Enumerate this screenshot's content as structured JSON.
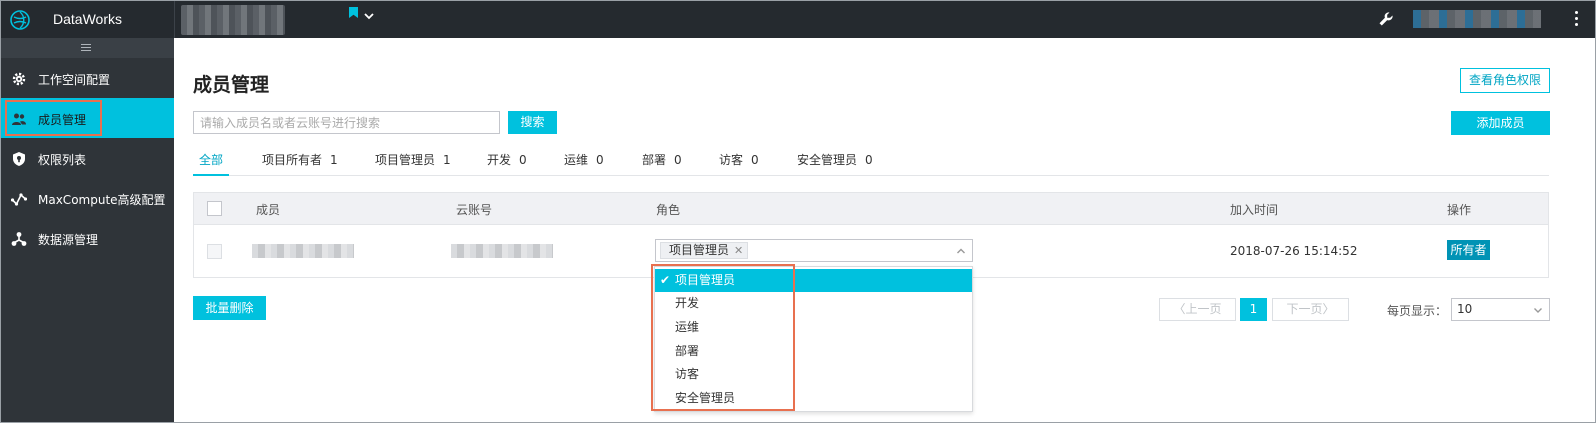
{
  "topbar": {
    "brand_name": "DataWorks"
  },
  "sidebar": {
    "items": [
      {
        "label": "工作空间配置",
        "icon": "gear-icon"
      },
      {
        "label": "成员管理",
        "icon": "users-icon",
        "active": true
      },
      {
        "label": "权限列表",
        "icon": "shield-icon"
      },
      {
        "label": "MaxCompute高级配置",
        "icon": "nodes-icon"
      },
      {
        "label": "数据源管理",
        "icon": "datasource-icon"
      }
    ]
  },
  "main": {
    "title": "成员管理",
    "view_role_permissions_label": "查看角色权限",
    "search": {
      "placeholder": "请输入成员名或者云账号进行搜索",
      "value": "",
      "button_label": "搜索"
    },
    "add_member_label": "添加成员",
    "tabs": [
      {
        "label": "全部",
        "count": ""
      },
      {
        "label": "项目所有者",
        "count": "1"
      },
      {
        "label": "项目管理员",
        "count": "1"
      },
      {
        "label": "开发",
        "count": "0"
      },
      {
        "label": "运维",
        "count": "0"
      },
      {
        "label": "部署",
        "count": "0"
      },
      {
        "label": "访客",
        "count": "0"
      },
      {
        "label": "安全管理员",
        "count": "0"
      }
    ],
    "table": {
      "columns": {
        "member": "成员",
        "cloud_account": "云账号",
        "role": "角色",
        "join_time": "加入时间",
        "actions": "操作"
      },
      "rows": [
        {
          "role_tag": "项目管理员",
          "join_time": "2018-07-26 15:14:52",
          "owner_badge": "所有者"
        }
      ]
    },
    "role_dropdown": {
      "options": [
        "项目管理员",
        "开发",
        "运维",
        "部署",
        "访客",
        "安全管理员"
      ],
      "selected": "项目管理员",
      "check_mark": "✔"
    },
    "bulk_delete_label": "批量删除",
    "pagination": {
      "prev_label": "上一页",
      "next_label": "下一页",
      "current_page": "1",
      "page_size_label": "每页显示：",
      "page_size_value": "10"
    }
  },
  "colors": {
    "accent": "#00c1de",
    "topbar_bg": "#252a2f",
    "sidebar_bg": "#2f3439",
    "highlight_box": "#e8704f"
  }
}
